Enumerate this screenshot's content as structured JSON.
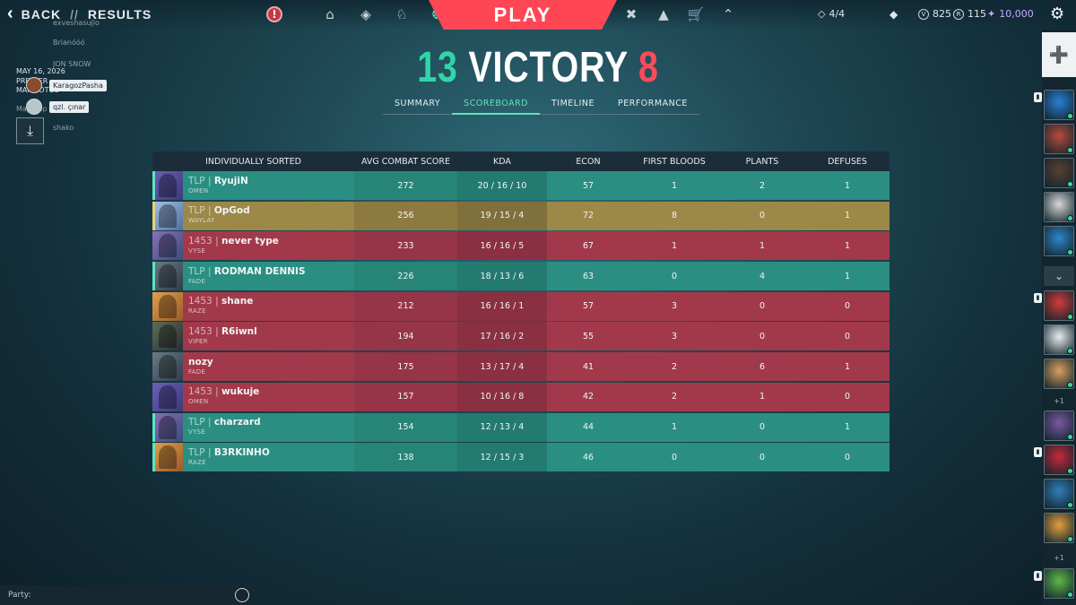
{
  "header": {
    "back_label": "BACK",
    "separator": "//",
    "section": "RESULTS",
    "play_label": "PLAY",
    "nav_icons": [
      "alert-icon",
      "home-icon",
      "agents-icon",
      "career-icon",
      "battlepass-icon"
    ],
    "nav_right_icons": [
      "esports-icon",
      "collection-icon",
      "store-icon",
      "rank-icon"
    ],
    "party_size": "4/4",
    "valorant_points": "825",
    "radianite_points": "115",
    "kingdom_credits": "10,000"
  },
  "side_overlay": {
    "lines": [
      "exveshasujlo",
      "Brianóóó",
      "JON SNOW",
      "MAY 16, 2026",
      "PREMIER",
      "MAP ROTOS",
      "Map Rep",
      "shako"
    ],
    "friend_tags": [
      "KaragozPasha",
      "qzl. çınar"
    ]
  },
  "score": {
    "ally_rounds": "13",
    "result": "VICTORY",
    "enemy_rounds": "8"
  },
  "tabs": [
    {
      "label": "SUMMARY",
      "active": false
    },
    {
      "label": "SCOREBOARD",
      "active": true
    },
    {
      "label": "TIMELINE",
      "active": false
    },
    {
      "label": "PERFORMANCE",
      "active": false
    }
  ],
  "scoreboard": {
    "columns": [
      "INDIVIDUALLY SORTED",
      "AVG COMBAT SCORE",
      "KDA",
      "ECON",
      "FIRST BLOODS",
      "PLANTS",
      "DEFUSES"
    ],
    "rows": [
      {
        "team": "ally",
        "tag": "TLP",
        "name": "RyujiN",
        "agent": "OMEN",
        "acs": "272",
        "kda": "20 / 16 / 10",
        "econ": "57",
        "fb": "1",
        "plants": "2",
        "defuses": "1"
      },
      {
        "team": "self",
        "tag": "TLP",
        "name": "OpGod",
        "agent": "WAYLAY",
        "acs": "256",
        "kda": "19 / 15 / 4",
        "econ": "72",
        "fb": "8",
        "plants": "0",
        "defuses": "1"
      },
      {
        "team": "enemy",
        "tag": "1453",
        "name": "never type",
        "agent": "VYSE",
        "acs": "233",
        "kda": "16 / 16 / 5",
        "econ": "67",
        "fb": "1",
        "plants": "1",
        "defuses": "1"
      },
      {
        "team": "ally",
        "tag": "TLP",
        "name": "RODMAN DENNIS",
        "agent": "FADE",
        "acs": "226",
        "kda": "18 / 13 / 6",
        "econ": "63",
        "fb": "0",
        "plants": "4",
        "defuses": "1"
      },
      {
        "team": "enemy",
        "tag": "1453",
        "name": "shane",
        "agent": "RAZE",
        "acs": "212",
        "kda": "16 / 16 / 1",
        "econ": "57",
        "fb": "3",
        "plants": "0",
        "defuses": "0"
      },
      {
        "team": "enemy",
        "tag": "1453",
        "name": "R6iwnl",
        "agent": "VIPER",
        "acs": "194",
        "kda": "17 / 16 / 2",
        "econ": "55",
        "fb": "3",
        "plants": "0",
        "defuses": "0"
      },
      {
        "team": "enemy",
        "tag": "",
        "name": "nozy",
        "agent": "FADE",
        "acs": "175",
        "kda": "13 / 17 / 4",
        "econ": "41",
        "fb": "2",
        "plants": "6",
        "defuses": "1"
      },
      {
        "team": "enemy",
        "tag": "1453",
        "name": "wukuje",
        "agent": "OMEN",
        "acs": "157",
        "kda": "10 / 16 / 8",
        "econ": "42",
        "fb": "2",
        "plants": "1",
        "defuses": "0"
      },
      {
        "team": "ally",
        "tag": "TLP",
        "name": "charzard",
        "agent": "VYSE",
        "acs": "154",
        "kda": "12 / 13 / 4",
        "econ": "44",
        "fb": "1",
        "plants": "0",
        "defuses": "1"
      },
      {
        "team": "ally",
        "tag": "TLP",
        "name": "B3RKINHO",
        "agent": "RAZE",
        "acs": "138",
        "kda": "12 / 15 / 3",
        "econ": "46",
        "fb": "0",
        "plants": "0",
        "defuses": "0"
      }
    ]
  },
  "social": {
    "more_counts": [
      "+1",
      "+1"
    ]
  },
  "party_chat": {
    "label": "Party:"
  },
  "colors": {
    "ally": "#2fd6a8",
    "enemy": "#ff4a5a",
    "play": "#ff4655",
    "ally_row": "#2a8f82",
    "enemy_row": "#a2394a",
    "self_row": "#9c8847"
  }
}
